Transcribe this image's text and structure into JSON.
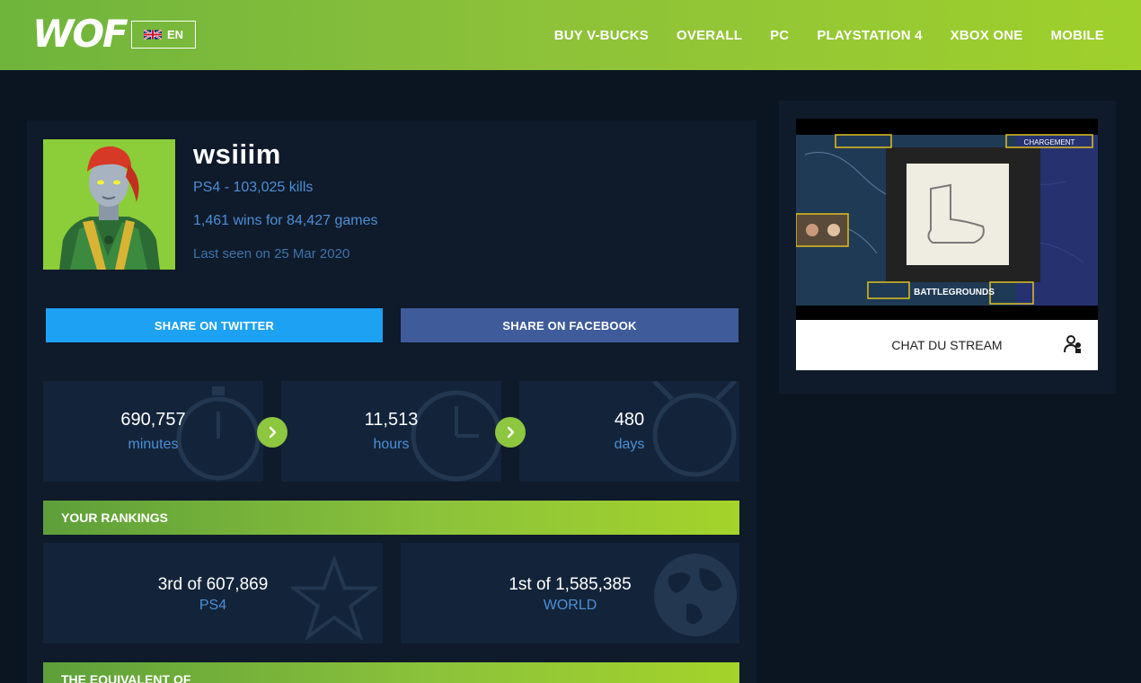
{
  "header": {
    "logo": "WOF",
    "language": "EN",
    "nav": [
      "BUY V-BUCKS",
      "OVERALL",
      "PC",
      "PLAYSTATION 4",
      "XBOX ONE",
      "MOBILE"
    ]
  },
  "profile": {
    "name": "wsiiim",
    "platform_kills": "PS4 - 103,025 kills",
    "wins_games": "1,461 wins for 84,427 games",
    "last_seen": "Last seen on 25 Mar 2020"
  },
  "share": {
    "twitter": "SHARE ON TWITTER",
    "facebook": "SHARE ON FACEBOOK"
  },
  "playtime": [
    {
      "value": "690,757",
      "unit": "minutes"
    },
    {
      "value": "11,513",
      "unit": "hours"
    },
    {
      "value": "480",
      "unit": "days"
    }
  ],
  "rankings": {
    "title": "YOUR RANKINGS",
    "items": [
      {
        "value": "3rd of 607,869",
        "label": "PS4"
      },
      {
        "value": "1st of 1,585,385",
        "label": "WORLD"
      }
    ]
  },
  "equivalent": {
    "title": "THE EQUIVALENT OF"
  },
  "stream": {
    "chat_label": "CHAT DU STREAM",
    "overlay_text": "CHARGEMENT",
    "game_logo": "BATTLEGROUNDS"
  },
  "colors": {
    "accent_green": "#8dc63f",
    "twitter_blue": "#1da1f2",
    "facebook_blue": "#3f5b9a",
    "link_blue": "#4c8fd6",
    "background": "#0b1522"
  }
}
